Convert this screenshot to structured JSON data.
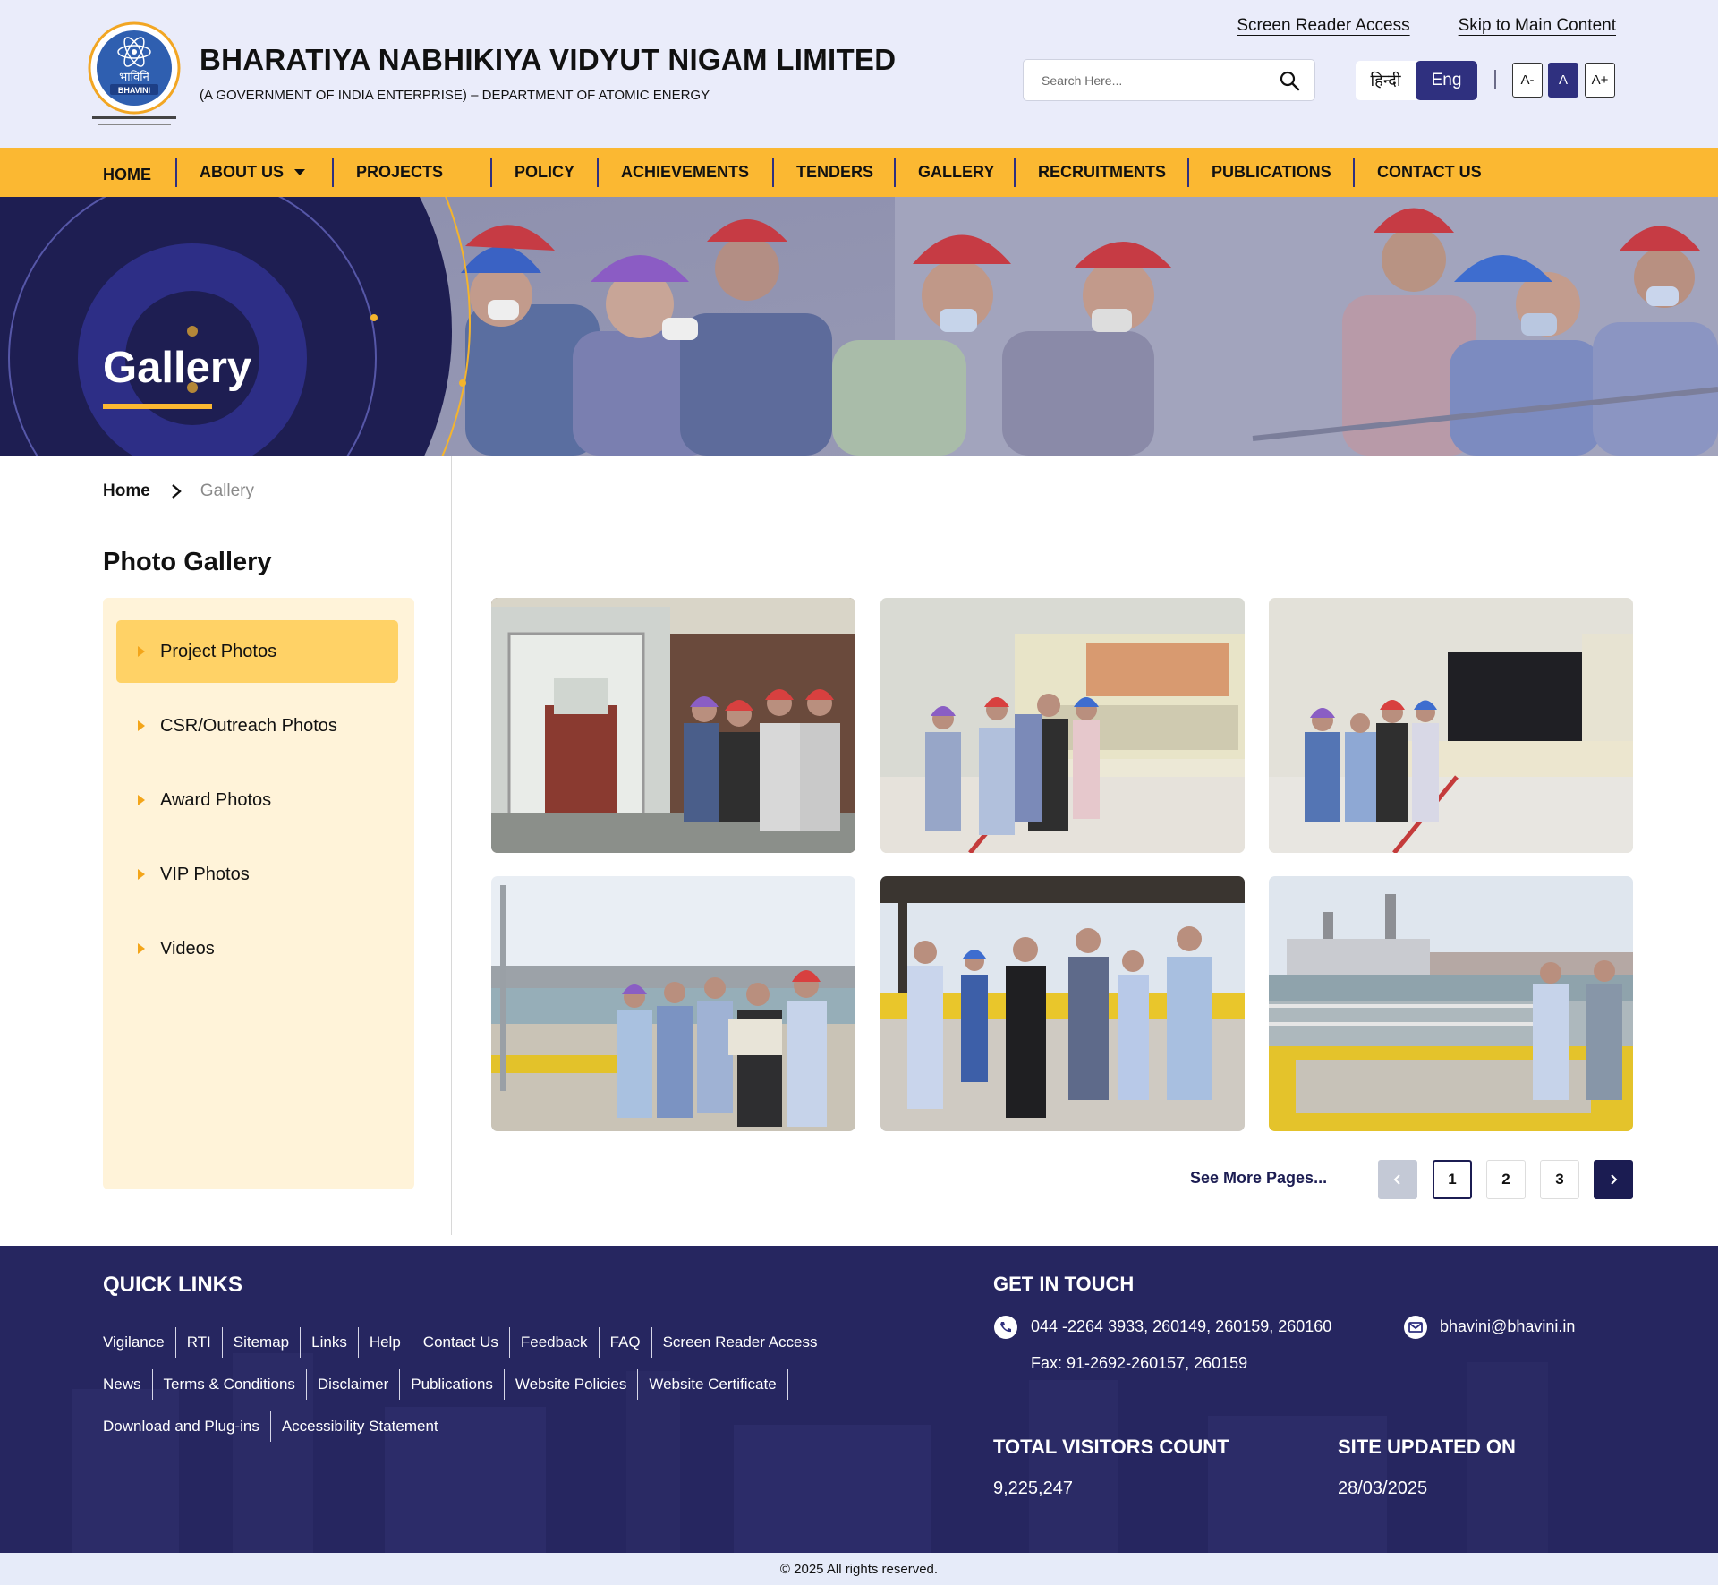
{
  "header": {
    "org_name": "BHARATIYA NABHIKIYA VIDYUT NIGAM LIMITED",
    "org_subtitle": "(A GOVERNMENT OF INDIA ENTERPRISE) – DEPARTMENT OF ATOMIC ENERGY",
    "logo_text": "भाविनि BHAVINI",
    "screen_reader_access": "Screen Reader Access",
    "skip_to_main": "Skip to Main Content",
    "search_placeholder": "Search Here...",
    "lang_hindi": "हिन्दी",
    "lang_english": "Eng",
    "font_decrease": "A-",
    "font_normal": "A",
    "font_increase": "A+"
  },
  "nav": {
    "home": "HOME",
    "about": "ABOUT US",
    "projects": "PROJECTS",
    "policy": "POLICY",
    "achievements": "ACHIEVEMENTS",
    "tenders": "TENDERS",
    "gallery": "GALLERY",
    "recruitments": "RECRUITMENTS",
    "publications": "PUBLICATIONS",
    "contact": "CONTACT US"
  },
  "banner": {
    "title": "Gallery"
  },
  "breadcrumb": {
    "home": "Home",
    "current": "Gallery"
  },
  "sidebar": {
    "title": "Photo Gallery",
    "items": [
      {
        "label": "Project Photos",
        "active": true
      },
      {
        "label": "CSR/Outreach Photos",
        "active": false
      },
      {
        "label": "Award Photos",
        "active": false
      },
      {
        "label": "VIP Photos",
        "active": false
      },
      {
        "label": "Videos",
        "active": false
      }
    ]
  },
  "pagination": {
    "see_more": "See More Pages...",
    "pages": [
      "1",
      "2",
      "3"
    ],
    "current_page": "1"
  },
  "footer": {
    "quick_links_title": "QUICK LINKS",
    "quick_links_row1": [
      "Vigilance",
      "RTI",
      "Sitemap",
      "Links",
      "Help",
      "Contact Us",
      "Feedback",
      "FAQ",
      "Screen Reader Access"
    ],
    "quick_links_row2": [
      "News",
      "Terms & Conditions",
      "Disclaimer",
      "Publications",
      "Website Policies",
      "Website Certificate"
    ],
    "quick_links_row3": [
      "Download and Plug-ins",
      "Accessibility Statement"
    ],
    "get_in_touch_title": "GET IN TOUCH",
    "phone": "044 -2264 3933, 260149, 260159, 260160",
    "fax": "Fax: 91-2692-260157, 260159",
    "email": "bhavini@bhavini.in",
    "visitors_title": "TOTAL VISITORS COUNT",
    "visitors_value": "9,225,247",
    "updated_title": "SITE UPDATED ON",
    "updated_value": "28/03/2025",
    "copyright": "© 2025 All rights reserved."
  },
  "colors": {
    "navy": "#2f307f",
    "footer_navy": "#262660",
    "accent_yellow": "#fbb832",
    "sidebar_bg": "#fff3d9",
    "sidebar_active": "#ffd266",
    "header_bg": "#eaecfa"
  }
}
